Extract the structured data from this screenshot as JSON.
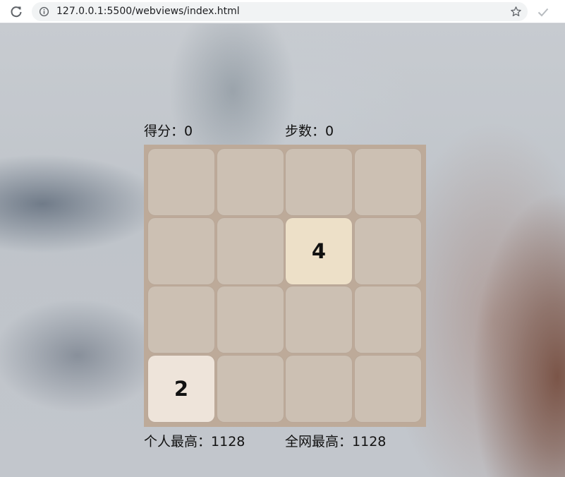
{
  "browser": {
    "url": "127.0.0.1:5500/webviews/index.html",
    "icons": [
      "reload-icon",
      "info-icon",
      "star-icon",
      "check-icon"
    ]
  },
  "game": {
    "score_label": "得分：",
    "score_value": "0",
    "steps_label": "步数：",
    "steps_value": "0",
    "personal_best_label": "个人最高：",
    "personal_best_value": "1128",
    "global_best_label": "全网最高：",
    "global_best_value": "1128",
    "board": [
      [
        null,
        null,
        null,
        null
      ],
      [
        null,
        null,
        4,
        null
      ],
      [
        null,
        null,
        null,
        null
      ],
      [
        2,
        null,
        null,
        null
      ]
    ],
    "colors": {
      "board": "#bdaa99",
      "empty": "#ccc0b3",
      "2": "#eee4da",
      "4": "#ede0c8"
    }
  }
}
